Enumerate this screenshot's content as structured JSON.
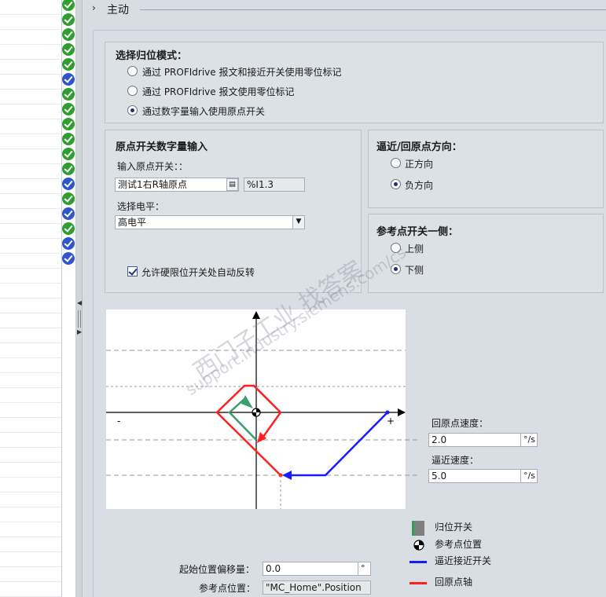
{
  "section": {
    "title": "主动"
  },
  "homing_mode": {
    "title": "选择归位模式：",
    "options": [
      {
        "label": "通过 PROFIdrive 报文和接近开关使用零位标记",
        "checked": false
      },
      {
        "label": "通过 PROFIdrive 报文使用零位标记",
        "checked": false
      },
      {
        "label": "通过数字量输入使用原点开关",
        "checked": true
      }
    ]
  },
  "home_switch_input": {
    "title": "原点开关数字量输入",
    "input_label": "输入原点开关：：",
    "input_value": "测试1右R轴原点",
    "address_value": "%I1.3",
    "level_label": "选择电平：",
    "level_value": "高电平",
    "auto_reverse_label": "允许硬限位开关处自动反转",
    "auto_reverse_checked": true
  },
  "direction": {
    "title": "逼近/回原点方向：",
    "options": [
      {
        "label": "正方向",
        "checked": false
      },
      {
        "label": "负方向",
        "checked": true
      }
    ]
  },
  "ref_side": {
    "title": "参考点开关一侧：",
    "options": [
      {
        "label": "上侧",
        "checked": false
      },
      {
        "label": "下侧",
        "checked": true
      }
    ]
  },
  "diagram": {
    "minus_sign": "-",
    "plus_sign": "+",
    "colors": {
      "approach": "#1a1aff",
      "homing": "#ff2020",
      "switch": "#7f7f7f",
      "switch_edge": "#2e9e5e",
      "short_arrow": "#3a9e6e"
    }
  },
  "speeds": {
    "home_speed_label": "回原点速度：",
    "home_speed_value": "2.0",
    "approach_speed_label": "逼近速度：",
    "approach_speed_value": "5.0",
    "unit": "°/s"
  },
  "legend": {
    "items": [
      {
        "label": "归位开关",
        "icon": "homing-switch-icon"
      },
      {
        "label": "参考点位置",
        "icon": "reference-point-icon"
      },
      {
        "label": "逼近接近开关",
        "icon": "blue-line-icon"
      },
      {
        "label": "回原点轴",
        "icon": "red-line-icon"
      }
    ]
  },
  "offset": {
    "label": "起始位置偏移量：",
    "value": "0.0",
    "unit": "°"
  },
  "ref_position": {
    "label": "参考点位置：",
    "value": "\"MC_Home\".Position"
  },
  "watermark": {
    "line1": "西门子工业  找答案",
    "line2": "support.industry.siemens.com/cs"
  },
  "status_icons": [
    "green",
    "green",
    "green",
    "green",
    "green",
    "blue",
    "green",
    "green",
    "green",
    "green",
    "green",
    "green",
    "blue",
    "green",
    "blue",
    "green",
    "blue",
    "blue"
  ]
}
